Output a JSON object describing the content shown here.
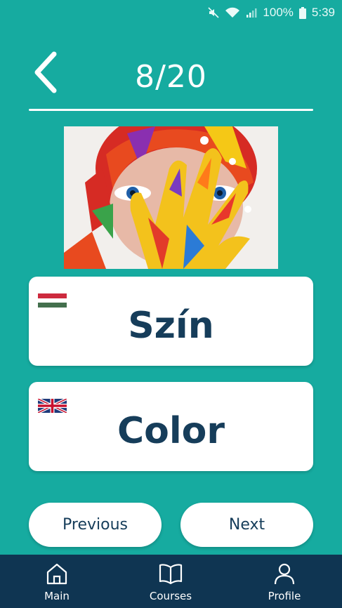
{
  "status_bar": {
    "battery": "100%",
    "time": "5:39",
    "icons": [
      "mute-icon",
      "wifi-icon",
      "signal-icon",
      "battery-icon"
    ]
  },
  "header": {
    "progress": "8/20",
    "back_icon": "chevron-left-icon"
  },
  "image": {
    "subject": "colorful-painted-face-photo"
  },
  "cards": {
    "hungarian": {
      "flag": "hungary-flag-icon",
      "word": "Szín"
    },
    "english": {
      "flag": "uk-flag-icon",
      "word": "Color"
    }
  },
  "buttons": {
    "previous": "Previous",
    "next": "Next"
  },
  "bottom_nav": {
    "items": [
      {
        "label": "Main",
        "icon": "home-icon"
      },
      {
        "label": "Courses",
        "icon": "book-icon"
      },
      {
        "label": "Profile",
        "icon": "user-icon"
      }
    ]
  },
  "colors": {
    "background": "#16aba0",
    "nav_background": "#0f3552",
    "text_dark": "#163d5a"
  }
}
